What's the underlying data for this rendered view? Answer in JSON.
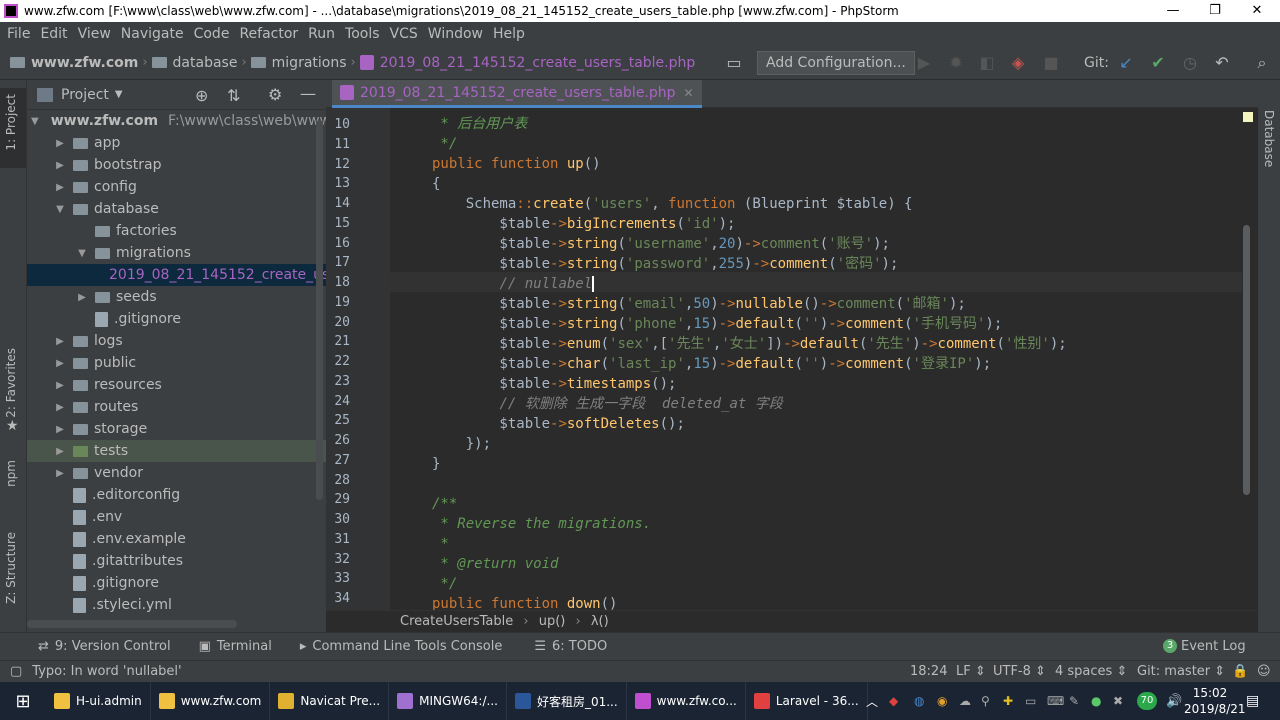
{
  "window_title": "www.zfw.com [F:\\www\\class\\web\\www.zfw.com] - ...\\database\\migrations\\2019_08_21_145152_create_users_table.php [www.zfw.com] - PhpStorm",
  "menu": [
    "File",
    "Edit",
    "View",
    "Navigate",
    "Code",
    "Refactor",
    "Run",
    "Tools",
    "VCS",
    "Window",
    "Help"
  ],
  "nav": {
    "root": "www.zfw.com",
    "items": [
      "database",
      "migrations",
      "2019_08_21_145152_create_users_table.php"
    ],
    "add_config": "Add Configuration...",
    "git_label": "Git:"
  },
  "project": {
    "title": "Project",
    "root_name": "www.zfw.com",
    "root_path": "F:\\www\\class\\web\\www.",
    "items": [
      {
        "label": "app",
        "depth": 1,
        "arrow": "right",
        "type": "folder"
      },
      {
        "label": "bootstrap",
        "depth": 1,
        "arrow": "right",
        "type": "folder"
      },
      {
        "label": "config",
        "depth": 1,
        "arrow": "right",
        "type": "folder"
      },
      {
        "label": "database",
        "depth": 1,
        "arrow": "down",
        "type": "folder"
      },
      {
        "label": "factories",
        "depth": 2,
        "arrow": "",
        "type": "folder"
      },
      {
        "label": "migrations",
        "depth": 2,
        "arrow": "down",
        "type": "folder"
      },
      {
        "label": "2019_08_21_145152_create_us",
        "depth": 3,
        "arrow": "",
        "type": "php",
        "selected": true
      },
      {
        "label": "seeds",
        "depth": 2,
        "arrow": "right",
        "type": "folder"
      },
      {
        "label": ".gitignore",
        "depth": 2,
        "arrow": "",
        "type": "file"
      },
      {
        "label": "logs",
        "depth": 1,
        "arrow": "right",
        "type": "folder"
      },
      {
        "label": "public",
        "depth": 1,
        "arrow": "right",
        "type": "folder"
      },
      {
        "label": "resources",
        "depth": 1,
        "arrow": "right",
        "type": "folder"
      },
      {
        "label": "routes",
        "depth": 1,
        "arrow": "right",
        "type": "folder"
      },
      {
        "label": "storage",
        "depth": 1,
        "arrow": "right",
        "type": "folder"
      },
      {
        "label": "tests",
        "depth": 1,
        "arrow": "right",
        "type": "folder-green",
        "highlight": true
      },
      {
        "label": "vendor",
        "depth": 1,
        "arrow": "right",
        "type": "folder"
      },
      {
        "label": ".editorconfig",
        "depth": 1,
        "arrow": "",
        "type": "file"
      },
      {
        "label": ".env",
        "depth": 1,
        "arrow": "",
        "type": "file"
      },
      {
        "label": ".env.example",
        "depth": 1,
        "arrow": "",
        "type": "file"
      },
      {
        "label": ".gitattributes",
        "depth": 1,
        "arrow": "",
        "type": "file"
      },
      {
        "label": ".gitignore",
        "depth": 1,
        "arrow": "",
        "type": "file"
      },
      {
        "label": ".styleci.yml",
        "depth": 1,
        "arrow": "",
        "type": "file"
      }
    ]
  },
  "side_tabs": {
    "project": "1: Project",
    "favorites": "2: Favorites",
    "npm": "npm",
    "structure": "Z: Structure",
    "database": "Database"
  },
  "editor": {
    "tab_label": "2019_08_21_145152_create_users_table.php",
    "line_numbers": [
      "10",
      "11",
      "12",
      "13",
      "14",
      "15",
      "16",
      "17",
      "18",
      "19",
      "20",
      "21",
      "22",
      "23",
      "24",
      "25",
      "26",
      "27",
      "28",
      "29",
      "30",
      "31",
      "32",
      "33",
      "34"
    ],
    "breadcrumb": [
      "CreateUsersTable",
      "up()",
      "λ()"
    ]
  },
  "bottom_tools": [
    "9: Version Control",
    "Terminal",
    "Command Line Tools Console",
    "6: TODO",
    "Event Log"
  ],
  "event_log_count": "3",
  "status": {
    "message": "Typo: In word 'nullabel'",
    "position": "18:24",
    "line_sep": "LF",
    "encoding": "UTF-8",
    "indent": "4 spaces",
    "git": "Git: master"
  },
  "taskbar": {
    "items": [
      {
        "label": "H-ui.admin",
        "color": "#f0c040"
      },
      {
        "label": "www.zfw.com",
        "color": "#f0c040"
      },
      {
        "label": "Navicat Pre...",
        "color": "#e0b030"
      },
      {
        "label": "MINGW64:/...",
        "color": "#a070d0"
      },
      {
        "label": "好客租房_01...",
        "color": "#2b579a"
      },
      {
        "label": "www.zfw.co...",
        "color": "#c04fd0"
      },
      {
        "label": "Laravel - 36...",
        "color": "#e04040"
      }
    ],
    "time": "15:02",
    "date": "2019/8/21",
    "badge": "70"
  }
}
